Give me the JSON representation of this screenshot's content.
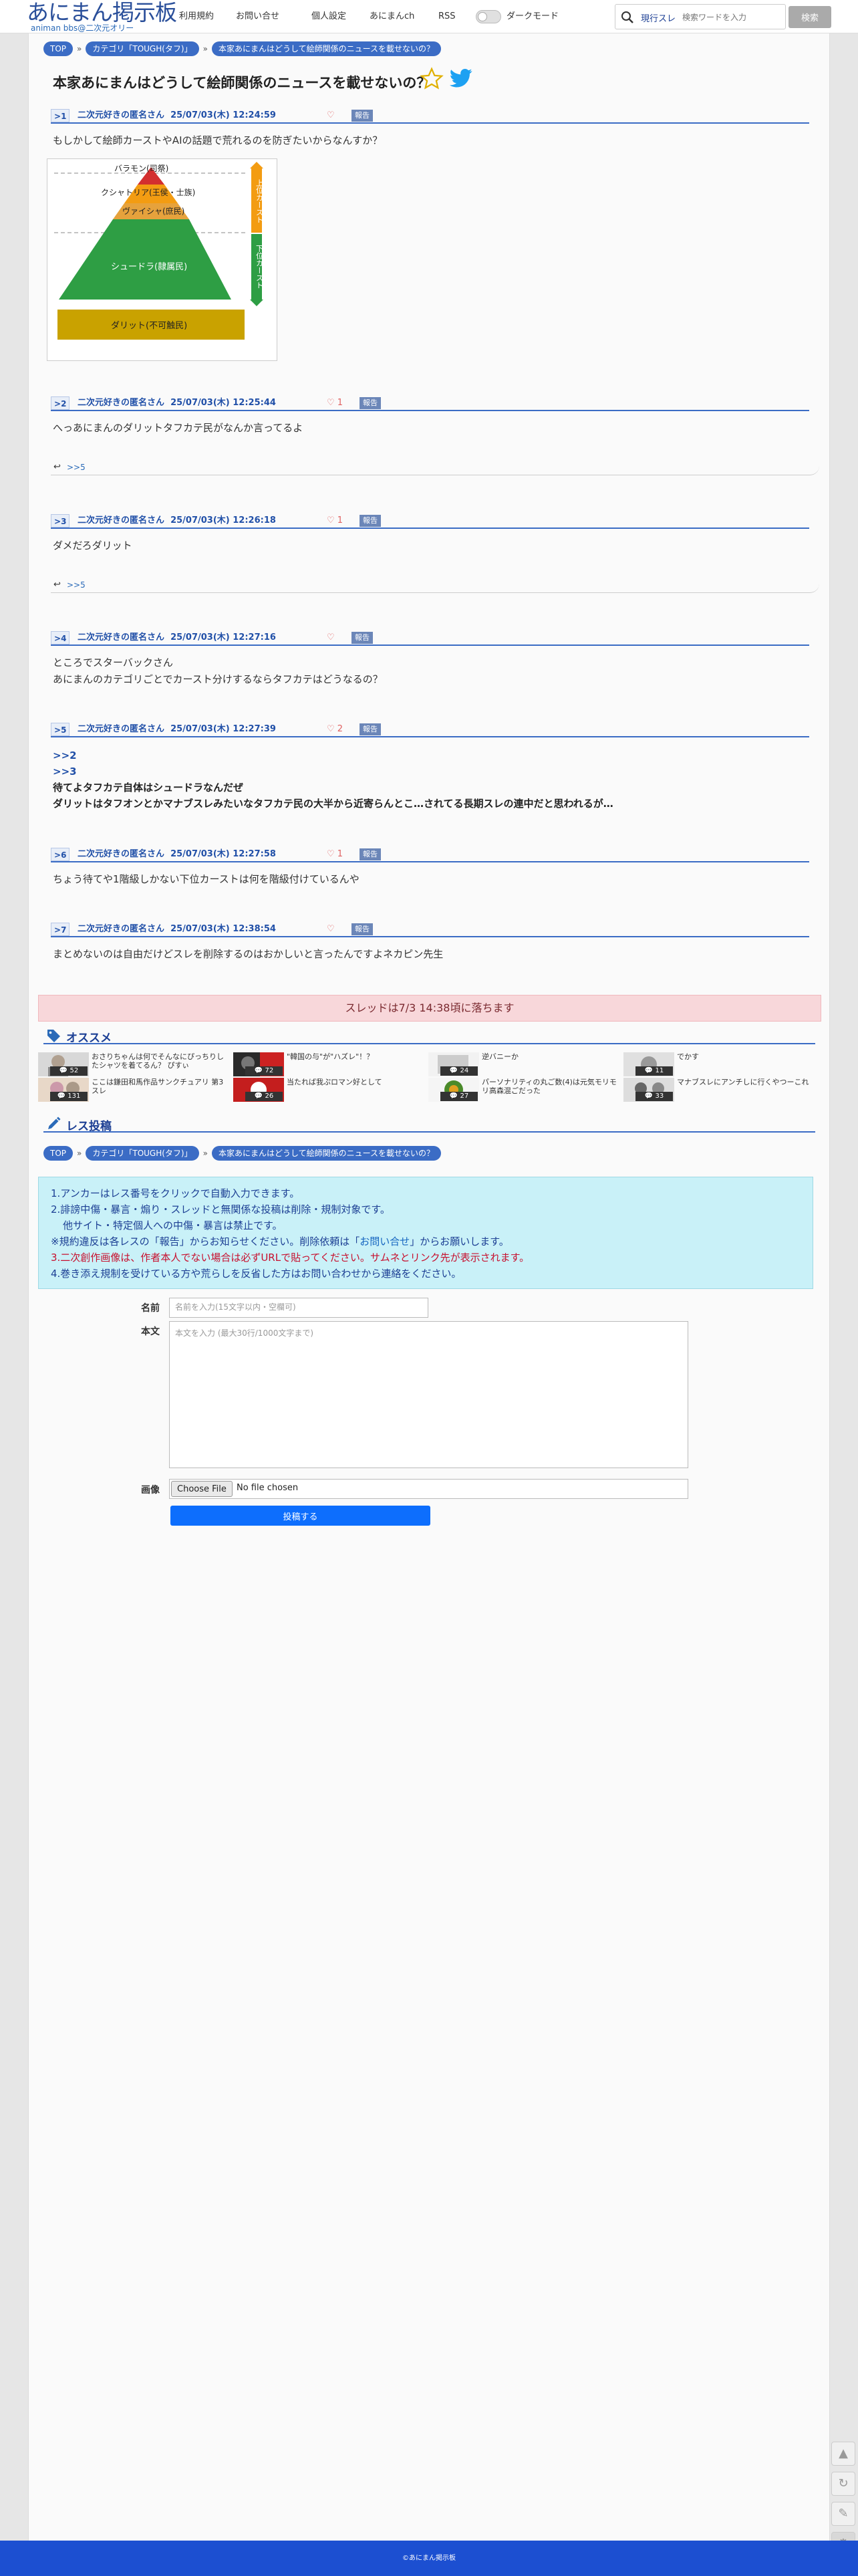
{
  "header": {
    "logo_title": "あにまん掲示板",
    "logo_sub": "animan bbs@二次元オリー",
    "nav": [
      "利用規約",
      "お問い合せ",
      "個人設定",
      "あにまんch",
      "RSS"
    ],
    "dark_mode_label": "ダークモード",
    "search_scope": "現行スレ",
    "search_placeholder": "検索ワードを入力",
    "search_button": "検索"
  },
  "breadcrumb": {
    "top": "TOP",
    "category": "カテゴリ「TOUGH(タフ)」",
    "thread": "本家あにまんはどうして絵師関係のニュースを載せないの？"
  },
  "thread": {
    "title": "本家あにまんはどうして絵師関係のニュースを載せないの？"
  },
  "posts": [
    {
      "no": "1",
      "name": "二次元好きの匿名さん",
      "date": "25/07/03(木) 12:24:59",
      "likes": "",
      "report": "報告",
      "lines": [
        "もしかして絵師カーストやAIの話題で荒れるのを防ぎたいからなんすか？"
      ]
    },
    {
      "no": "2",
      "name": "二次元好きの匿名さん",
      "date": "25/07/03(木) 12:25:44",
      "likes": "1",
      "report": "報告",
      "lines": [
        "へっあにまんのダリットタフカテ民がなんか言ってるよ"
      ],
      "reply": ">>5"
    },
    {
      "no": "3",
      "name": "二次元好きの匿名さん",
      "date": "25/07/03(木) 12:26:18",
      "likes": "1",
      "report": "報告",
      "lines": [
        "ダメだろダリット"
      ],
      "reply": ">>5"
    },
    {
      "no": "4",
      "name": "二次元好きの匿名さん",
      "date": "25/07/03(木) 12:27:16",
      "likes": "",
      "report": "報告",
      "lines": [
        "ところでスターバックさん",
        "あにまんのカテゴリごとでカースト分けするならタフカテはどうなるの？"
      ]
    },
    {
      "no": "5",
      "name": "二次元好きの匿名さん",
      "date": "25/07/03(木) 12:27:39",
      "likes": "2",
      "report": "報告",
      "anchors": [
        ">>2",
        ">>3"
      ],
      "lines": [
        "待てよタフカテ自体はシュードラなんだぜ",
        "ダリットはタフオンとかマナブスレみたいなタフカテ民の大半から近寄らんとこ…されてる長期スレの連中だと思われるが…"
      ]
    },
    {
      "no": "6",
      "name": "二次元好きの匿名さん",
      "date": "25/07/03(木) 12:27:58",
      "likes": "1",
      "report": "報告",
      "lines": [
        "ちょう待てや1階級しかない下位カーストは何を階級付けているんや"
      ]
    },
    {
      "no": "7",
      "name": "二次元好きの匿名さん",
      "date": "25/07/03(木) 12:38:54",
      "likes": "",
      "report": "報告",
      "lines": [
        "まとめないのは自由だけどスレを削除するのはおかしいと言ったんですよネカピン先生"
      ]
    }
  ],
  "pyramid": {
    "tiers": [
      "バラモン(司祭)",
      "クシャトリア(王侯・士族)",
      "ヴァイシャ(庶民)",
      "シュードラ(隷属民)",
      "ダリット(不可触民)"
    ],
    "upper_label": "上位カースト",
    "lower_label": "下位カースト",
    "colors": [
      "#d32f2f",
      "#f39c12",
      "#e6a23c",
      "#2e9e44",
      "#c9a200"
    ]
  },
  "drop_notice": "スレッドは7/3 14:38頃に落ちます",
  "recommend": {
    "heading": "オススメ",
    "items": [
      {
        "count": "52",
        "title": "おさりちゃんは何でそんなにぴっちりしたシャツを着てるん？ ぴすぃ"
      },
      {
        "count": "72",
        "title": "\"韓国の与\"が\"ハズレ\"！？"
      },
      {
        "count": "24",
        "title": "逆バニーか"
      },
      {
        "count": "11",
        "title": "でかす"
      },
      {
        "count": "131",
        "title": "ここは鎌田和馬作品サンクチュアリ 第3スレ"
      },
      {
        "count": "26",
        "title": "当たれば我ぷロマン好として"
      },
      {
        "count": "27",
        "title": "パーソナリティの丸ご数(4)は元気モリモリ高森混ごだった"
      },
      {
        "count": "33",
        "title": "マナブスレにアンチしに行くやつーこれ"
      }
    ]
  },
  "reply_section": {
    "heading": "レス投稿",
    "rules": {
      "r1": "1.アンカーはレス番号をクリックで自動入力できます。",
      "r2": "2.誹謗中傷・暴言・煽り・スレッドと無関係な投稿は削除・規制対象です。",
      "r2b": "他サイト・特定個人への中傷・暴言は禁止です。",
      "r2c_a": "※規約違反は各レスの「報告」からお知らせください。削除依頼は「",
      "r2c_link": "お問い合せ",
      "r2c_b": "」からお願いします。",
      "r3": "3.二次創作画像は、作者本人でない場合は必ずURLで貼ってください。サムネとリンク先が表示されます。",
      "r4": "4.巻き添え規制を受けている方や荒らしを反省した方はお問い合わせから連絡をください。"
    },
    "name_label": "名前",
    "name_placeholder": "名前を入力(15文字以内・空欄可)",
    "body_label": "本文",
    "body_placeholder": "本文を入力 (最大30行/1000文字まで)",
    "image_label": "画像",
    "choose_file": "Choose File",
    "no_file": "No file chosen",
    "submit": "投稿する"
  },
  "footer": "©あにまん掲示板"
}
